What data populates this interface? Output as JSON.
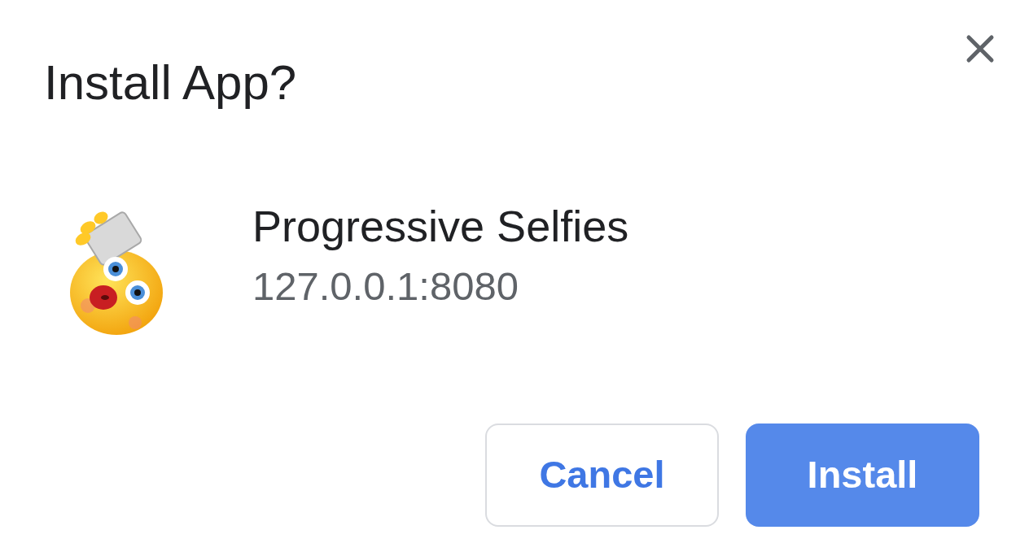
{
  "dialog": {
    "title": "Install App?"
  },
  "app": {
    "name": "Progressive Selfies",
    "origin": "127.0.0.1:8080"
  },
  "buttons": [
    {
      "label": "Cancel",
      "kind": "secondary"
    },
    {
      "label": "Install",
      "kind": "primary"
    }
  ]
}
